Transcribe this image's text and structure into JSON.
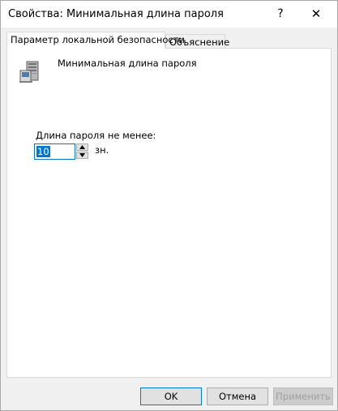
{
  "window": {
    "title": "Свойства: Минимальная длина пароля",
    "help_glyph": "?",
    "close_glyph": "✕"
  },
  "tabs": [
    {
      "label": "Параметр локальной безопасности",
      "active": true
    },
    {
      "label": "Объяснение",
      "active": false
    }
  ],
  "policy": {
    "name": "Минимальная длина пароля",
    "icon": "server-policy-icon"
  },
  "setting": {
    "label": "Длина пароля не менее:",
    "value": "10",
    "unit": "зн."
  },
  "buttons": {
    "ok": "OK",
    "cancel": "Отмена",
    "apply": "Применить"
  },
  "colors": {
    "accent": "#0078d7",
    "panel_bg": "#ffffff",
    "window_bg": "#f0f0f0",
    "disabled_text": "#a0a0a0"
  }
}
